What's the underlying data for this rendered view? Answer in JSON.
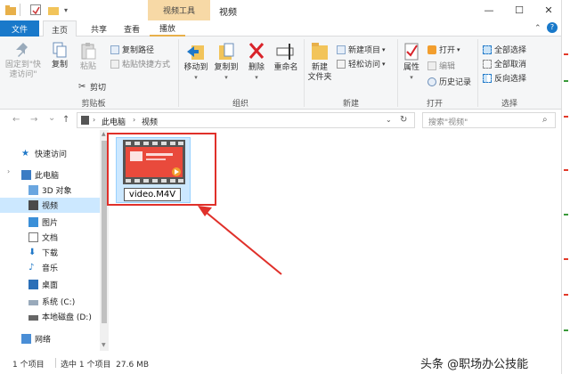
{
  "quick_access": {
    "checkbox_icon": "check-square-icon"
  },
  "title_bar": {
    "context_tab": "视频工具",
    "title": "视频",
    "minimize": "—",
    "maximize": "☐",
    "close": "✕"
  },
  "tabs": {
    "file": "文件",
    "home": "主页",
    "share": "共享",
    "view": "查看",
    "play": "播放"
  },
  "ribbon": {
    "clipboard": {
      "pin": "固定到\"快\n速访问\"",
      "copy": "复制",
      "paste": "粘贴",
      "copy_path": "复制路径",
      "paste_shortcut": "粘贴快捷方式",
      "cut": "剪切",
      "label": "剪贴板"
    },
    "organize": {
      "move_to": "移动到",
      "copy_to": "复制到",
      "delete": "删除",
      "rename": "重命名",
      "label": "组织"
    },
    "new": {
      "new_folder": "新建\n文件夹",
      "new_item": "新建项目",
      "easy_access": "轻松访问",
      "label": "新建"
    },
    "open": {
      "properties": "属性",
      "open": "打开",
      "edit": "编辑",
      "history": "历史记录",
      "label": "打开"
    },
    "select": {
      "select_all": "全部选择",
      "select_none": "全部取消",
      "invert": "反向选择",
      "label": "选择"
    }
  },
  "address": {
    "back": "←",
    "forward": "→",
    "dropdown": "⌄",
    "up": "↑",
    "path_root": "此电脑",
    "path_current": "视频",
    "search_placeholder": "搜索\"视频\""
  },
  "nav_pane": {
    "items": [
      {
        "label": "快速访问",
        "icon": "star-icon"
      },
      {
        "label": "此电脑",
        "icon": "computer-icon"
      },
      {
        "label": "3D 对象",
        "icon": "cube-icon"
      },
      {
        "label": "视频",
        "icon": "video-folder-icon",
        "selected": true
      },
      {
        "label": "图片",
        "icon": "pictures-icon"
      },
      {
        "label": "文档",
        "icon": "documents-icon"
      },
      {
        "label": "下载",
        "icon": "download-icon"
      },
      {
        "label": "音乐",
        "icon": "music-icon"
      },
      {
        "label": "桌面",
        "icon": "desktop-icon"
      },
      {
        "label": "系统 (C:)",
        "icon": "drive-c-icon"
      },
      {
        "label": "本地磁盘 (D:)",
        "icon": "drive-d-icon"
      },
      {
        "label": "网络",
        "icon": "network-icon"
      }
    ]
  },
  "file": {
    "rename_value": "video.M4V"
  },
  "status": {
    "item_count": "1 个项目",
    "selected": "选中 1 个项目  27.6 MB"
  },
  "watermark": "头条 @职场办公技能",
  "colors": {
    "file_tab": "#1979ca",
    "selection": "#cce8ff",
    "highlight_box": "#e0302a",
    "context_tab": "#f7d9a6"
  }
}
